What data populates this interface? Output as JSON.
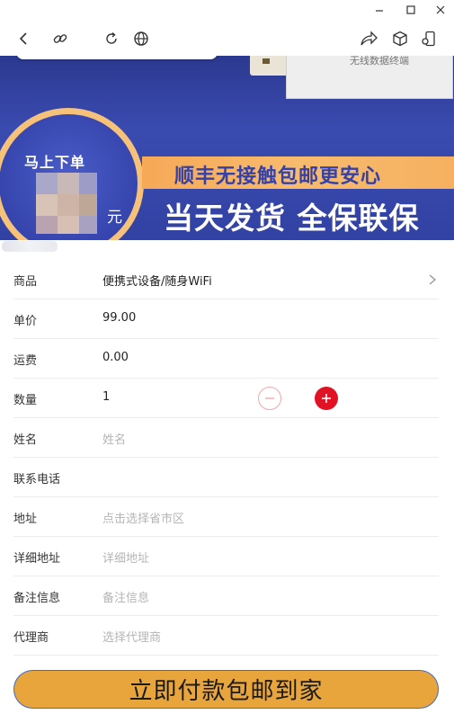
{
  "banner": {
    "device_text": "无线数据终端",
    "circle_text": "马上下单",
    "yuan": "元",
    "strip_text": "顺丰无接触包邮更安心",
    "slogan": "当天发货  全保联保"
  },
  "form": {
    "product": {
      "label": "商品",
      "value": "便携式设备/随身WiFi"
    },
    "price": {
      "label": "单价",
      "value": "99.00"
    },
    "shipping": {
      "label": "运费",
      "value": "0.00"
    },
    "quantity": {
      "label": "数量",
      "value": "1"
    },
    "name": {
      "label": "姓名",
      "placeholder": "姓名"
    },
    "phone": {
      "label": "联系电话",
      "placeholder": ""
    },
    "address": {
      "label": "地址",
      "placeholder": "点击选择省市区"
    },
    "detail_address": {
      "label": "详细地址",
      "placeholder": "详细地址"
    },
    "remark": {
      "label": "备注信息",
      "placeholder": "备注信息"
    },
    "agent": {
      "label": "代理商",
      "placeholder": "选择代理商"
    }
  },
  "pay_button": "立即付款包邮到家",
  "colors": {
    "accent": "#e01223",
    "button": "#e8a53c",
    "banner": "#3242a3",
    "strip": "#f6b060"
  },
  "icons": [
    "back-icon",
    "link-icon",
    "refresh-icon",
    "globe-icon",
    "share-icon",
    "cube-icon",
    "device-icon",
    "minimize-icon",
    "maximize-icon",
    "close-icon",
    "chevron-right-icon",
    "minus-icon",
    "plus-icon"
  ]
}
